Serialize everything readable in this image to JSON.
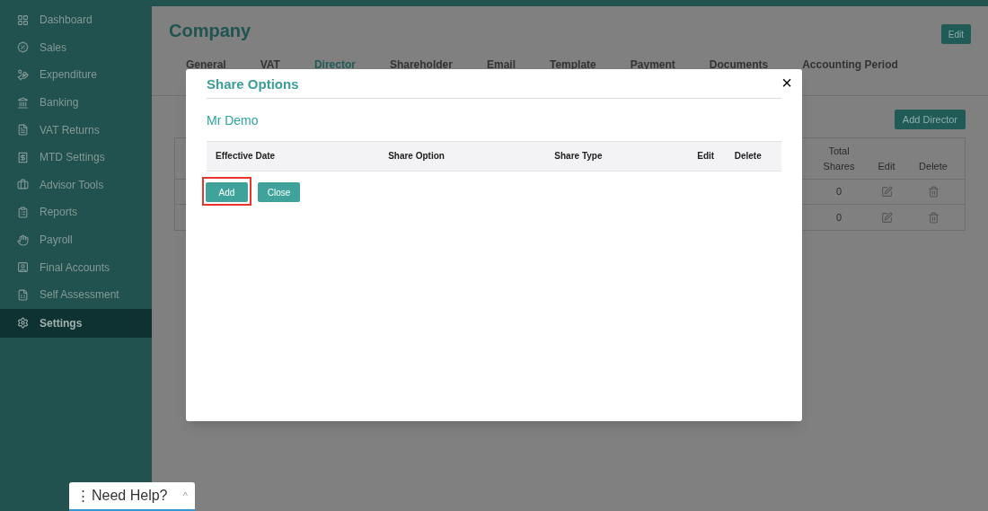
{
  "sidebar": {
    "items": [
      {
        "label": "Dashboard",
        "selected": false
      },
      {
        "label": "Sales",
        "selected": false
      },
      {
        "label": "Expenditure",
        "selected": false
      },
      {
        "label": "Banking",
        "selected": false
      },
      {
        "label": "VAT Returns",
        "selected": false
      },
      {
        "label": "MTD Settings",
        "selected": false
      },
      {
        "label": "Advisor Tools",
        "selected": false
      },
      {
        "label": "Reports",
        "selected": false
      },
      {
        "label": "Payroll",
        "selected": false
      },
      {
        "label": "Final Accounts",
        "selected": false
      },
      {
        "label": "Self Assessment",
        "selected": false
      },
      {
        "label": "Settings",
        "selected": true
      }
    ]
  },
  "page": {
    "title": "Company",
    "edit_button": "Edit",
    "tabs": [
      {
        "label": "General",
        "selected": false
      },
      {
        "label": "VAT",
        "selected": false
      },
      {
        "label": "Director",
        "selected": true
      },
      {
        "label": "Shareholder",
        "selected": false
      },
      {
        "label": "Email",
        "selected": false
      },
      {
        "label": "Template",
        "selected": false
      },
      {
        "label": "Payment",
        "selected": false
      },
      {
        "label": "Documents",
        "selected": false
      },
      {
        "label": "Accounting Period",
        "selected": false
      }
    ],
    "add_button": "Add Director",
    "table": {
      "columns": [
        "Total Shares",
        "Edit",
        "Delete"
      ],
      "rows": [
        {
          "total_shares": "0"
        },
        {
          "total_shares": "0"
        }
      ]
    }
  },
  "modal": {
    "title": "Share Options",
    "close": "×",
    "subtitle": "Mr Demo",
    "columns": [
      "Effective Date",
      "Share Option",
      "Share Type",
      "Edit",
      "Delete"
    ],
    "buttons": [
      {
        "label": "Add",
        "highlighted": true
      },
      {
        "label": "Close",
        "highlighted": false
      }
    ]
  },
  "help_widget": {
    "handle": "⋮",
    "label": "Need Help?",
    "caret": "^"
  }
}
